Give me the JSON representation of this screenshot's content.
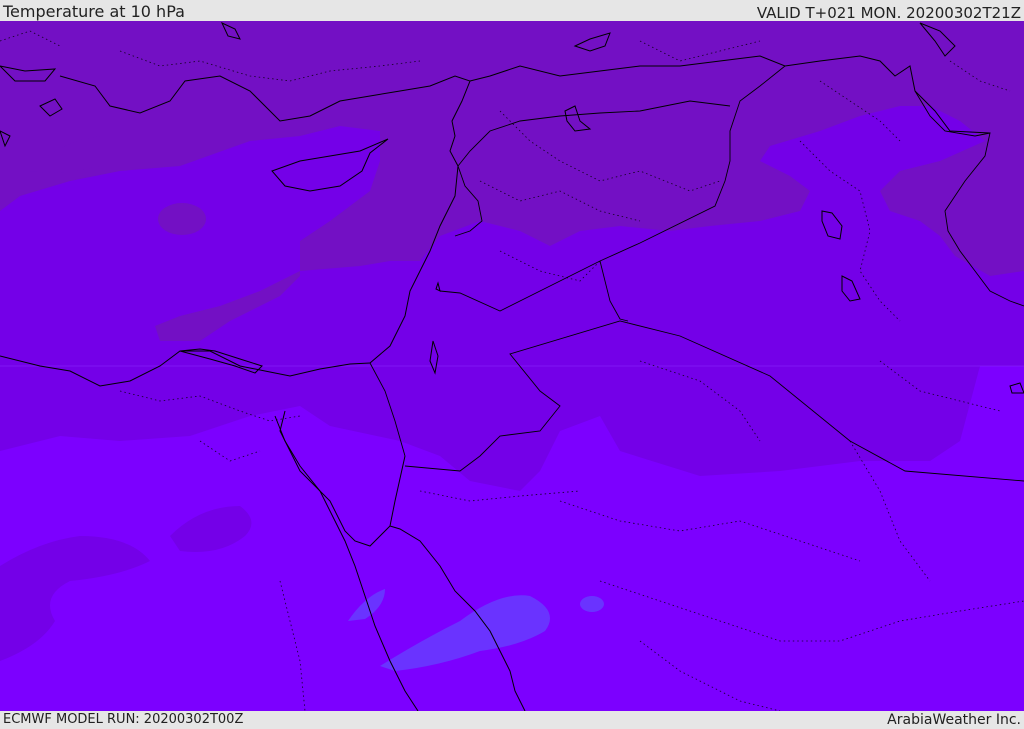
{
  "header": {
    "title": "Temperature at 10 hPa",
    "valid_time": "VALID T+021 MON. 20200302T21Z"
  },
  "footer": {
    "model_run": "ECMWF MODEL RUN: 20200302T00Z",
    "credit": "ArabiaWeather Inc."
  },
  "colors": {
    "band_warmest": "#7c00ff",
    "band_mid": "#7400e8",
    "band_cool": "#7310c4",
    "patch_blue": "#6a33ff",
    "coast": "#000000"
  },
  "icons": {
    "border_line": "solid-line",
    "internal_border": "dotted-line"
  }
}
